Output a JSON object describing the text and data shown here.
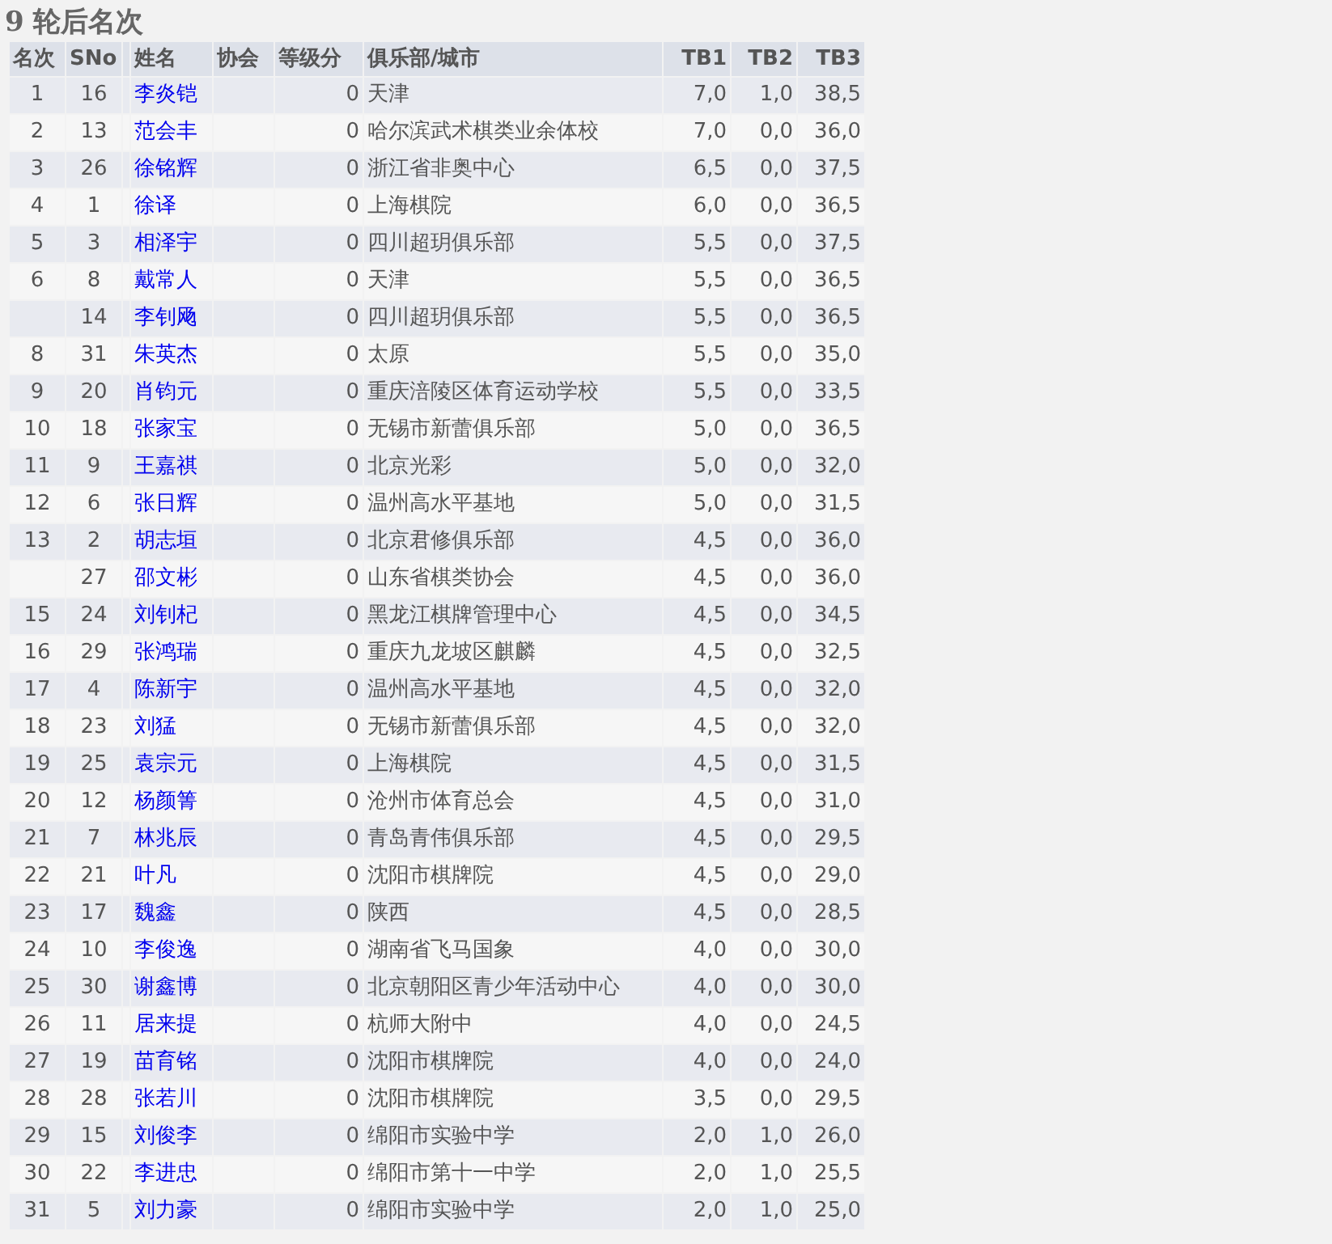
{
  "title": "9 轮后名次",
  "table": {
    "columns": [
      "名次",
      "SNo",
      "姓名",
      "协会",
      "等级分",
      "俱乐部/城市",
      "TB1",
      "TB2",
      "TB3"
    ],
    "rows": [
      {
        "rank": "1",
        "sno": "16",
        "name": "李炎铠",
        "rating": "0",
        "club": "天津",
        "tb1": "7,0",
        "tb2": "1,0",
        "tb3": "38,5"
      },
      {
        "rank": "2",
        "sno": "13",
        "name": "范会丰",
        "rating": "0",
        "club": "哈尔滨武术棋类业余体校",
        "tb1": "7,0",
        "tb2": "0,0",
        "tb3": "36,0"
      },
      {
        "rank": "3",
        "sno": "26",
        "name": "徐铭辉",
        "rating": "0",
        "club": "浙江省非奥中心",
        "tb1": "6,5",
        "tb2": "0,0",
        "tb3": "37,5"
      },
      {
        "rank": "4",
        "sno": "1",
        "name": "徐译",
        "rating": "0",
        "club": "上海棋院",
        "tb1": "6,0",
        "tb2": "0,0",
        "tb3": "36,5"
      },
      {
        "rank": "5",
        "sno": "3",
        "name": "相泽宇",
        "rating": "0",
        "club": "四川超玥俱乐部",
        "tb1": "5,5",
        "tb2": "0,0",
        "tb3": "37,5"
      },
      {
        "rank": "6",
        "sno": "8",
        "name": "戴常人",
        "rating": "0",
        "club": "天津",
        "tb1": "5,5",
        "tb2": "0,0",
        "tb3": "36,5"
      },
      {
        "sno": "14",
        "name": "李钊飏",
        "rating": "0",
        "club": "四川超玥俱乐部",
        "tb1": "5,5",
        "tb2": "0,0",
        "tb3": "36,5"
      },
      {
        "rank": "8",
        "sno": "31",
        "name": "朱英杰",
        "rating": "0",
        "club": "太原",
        "tb1": "5,5",
        "tb2": "0,0",
        "tb3": "35,0"
      },
      {
        "rank": "9",
        "sno": "20",
        "name": "肖钧元",
        "rating": "0",
        "club": "重庆涪陵区体育运动学校",
        "tb1": "5,5",
        "tb2": "0,0",
        "tb3": "33,5"
      },
      {
        "rank": "10",
        "sno": "18",
        "name": "张家宝",
        "rating": "0",
        "club": "无锡市新蕾俱乐部",
        "tb1": "5,0",
        "tb2": "0,0",
        "tb3": "36,5"
      },
      {
        "rank": "11",
        "sno": "9",
        "name": "王嘉祺",
        "rating": "0",
        "club": "北京光彩",
        "tb1": "5,0",
        "tb2": "0,0",
        "tb3": "32,0"
      },
      {
        "rank": "12",
        "sno": "6",
        "name": "张日辉",
        "rating": "0",
        "club": "温州高水平基地",
        "tb1": "5,0",
        "tb2": "0,0",
        "tb3": "31,5"
      },
      {
        "rank": "13",
        "sno": "2",
        "name": "胡志垣",
        "rating": "0",
        "club": "北京君修俱乐部",
        "tb1": "4,5",
        "tb2": "0,0",
        "tb3": "36,0"
      },
      {
        "sno": "27",
        "name": "邵文彬",
        "rating": "0",
        "club": "山东省棋类协会",
        "tb1": "4,5",
        "tb2": "0,0",
        "tb3": "36,0"
      },
      {
        "rank": "15",
        "sno": "24",
        "name": "刘钊杞",
        "rating": "0",
        "club": "黑龙江棋牌管理中心",
        "tb1": "4,5",
        "tb2": "0,0",
        "tb3": "34,5"
      },
      {
        "rank": "16",
        "sno": "29",
        "name": "张鸿瑞",
        "rating": "0",
        "club": "重庆九龙坡区麒麟",
        "tb1": "4,5",
        "tb2": "0,0",
        "tb3": "32,5"
      },
      {
        "rank": "17",
        "sno": "4",
        "name": "陈新宇",
        "rating": "0",
        "club": "温州高水平基地",
        "tb1": "4,5",
        "tb2": "0,0",
        "tb3": "32,0"
      },
      {
        "rank": "18",
        "sno": "23",
        "name": "刘猛",
        "rating": "0",
        "club": "无锡市新蕾俱乐部",
        "tb1": "4,5",
        "tb2": "0,0",
        "tb3": "32,0"
      },
      {
        "rank": "19",
        "sno": "25",
        "name": "袁宗元",
        "rating": "0",
        "club": "上海棋院",
        "tb1": "4,5",
        "tb2": "0,0",
        "tb3": "31,5"
      },
      {
        "rank": "20",
        "sno": "12",
        "name": "杨颜箐",
        "rating": "0",
        "club": "沧州市体育总会",
        "tb1": "4,5",
        "tb2": "0,0",
        "tb3": "31,0"
      },
      {
        "rank": "21",
        "sno": "7",
        "name": "林兆辰",
        "rating": "0",
        "club": "青岛青伟俱乐部",
        "tb1": "4,5",
        "tb2": "0,0",
        "tb3": "29,5"
      },
      {
        "rank": "22",
        "sno": "21",
        "name": "叶凡",
        "rating": "0",
        "club": "沈阳市棋牌院",
        "tb1": "4,5",
        "tb2": "0,0",
        "tb3": "29,0"
      },
      {
        "rank": "23",
        "sno": "17",
        "name": "魏鑫",
        "rating": "0",
        "club": "陕西",
        "tb1": "4,5",
        "tb2": "0,0",
        "tb3": "28,5"
      },
      {
        "rank": "24",
        "sno": "10",
        "name": "李俊逸",
        "rating": "0",
        "club": "湖南省飞马国象",
        "tb1": "4,0",
        "tb2": "0,0",
        "tb3": "30,0"
      },
      {
        "rank": "25",
        "sno": "30",
        "name": "谢鑫博",
        "rating": "0",
        "club": "北京朝阳区青少年活动中心",
        "tb1": "4,0",
        "tb2": "0,0",
        "tb3": "30,0"
      },
      {
        "rank": "26",
        "sno": "11",
        "name": "居来提",
        "rating": "0",
        "club": "杭师大附中",
        "tb1": "4,0",
        "tb2": "0,0",
        "tb3": "24,5"
      },
      {
        "rank": "27",
        "sno": "19",
        "name": "苗育铭",
        "rating": "0",
        "club": "沈阳市棋牌院",
        "tb1": "4,0",
        "tb2": "0,0",
        "tb3": "24,0"
      },
      {
        "rank": "28",
        "sno": "28",
        "name": "张若川",
        "rating": "0",
        "club": "沈阳市棋牌院",
        "tb1": "3,5",
        "tb2": "0,0",
        "tb3": "29,5"
      },
      {
        "rank": "29",
        "sno": "15",
        "name": "刘俊李",
        "rating": "0",
        "club": "绵阳市实验中学",
        "tb1": "2,0",
        "tb2": "1,0",
        "tb3": "26,0"
      },
      {
        "rank": "30",
        "sno": "22",
        "name": "李进忠",
        "rating": "0",
        "club": "绵阳市第十一中学",
        "tb1": "2,0",
        "tb2": "1,0",
        "tb3": "25,5"
      },
      {
        "rank": "31",
        "sno": "5",
        "name": "刘力豪",
        "rating": "0",
        "club": "绵阳市实验中学",
        "tb1": "2,0",
        "tb2": "1,0",
        "tb3": "25,0"
      }
    ]
  }
}
